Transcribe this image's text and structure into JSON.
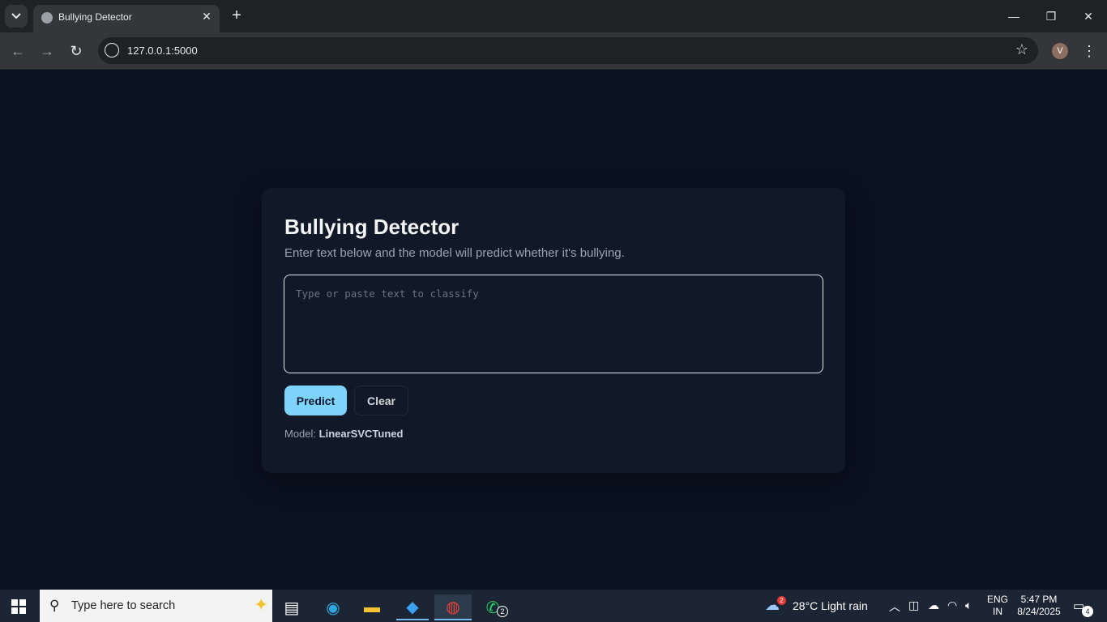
{
  "browser": {
    "tab_title": "Bullying Detector",
    "url": "127.0.0.1:5000",
    "profile_initial": "V"
  },
  "page": {
    "title": "Bullying Detector",
    "subtitle": "Enter text below and the model will predict whether it's bullying.",
    "input_placeholder": "Type or paste text to classify",
    "input_value": "",
    "predict_label": "Predict",
    "clear_label": "Clear",
    "model_prefix": "Model:",
    "model_name": "LinearSVCTuned"
  },
  "taskbar": {
    "search_placeholder": "Type here to search",
    "weather": "28°C  Light rain",
    "weather_badge": "2",
    "whatsapp_badge": "2",
    "lang_line1": "ENG",
    "lang_line2": "IN",
    "time": "5:47 PM",
    "date": "8/24/2025",
    "notification_count": "4"
  },
  "icons": {
    "tab_search": "chevron-down-icon",
    "back": "arrow-left-icon",
    "forward": "arrow-right-icon",
    "reload": "reload-icon",
    "bookmark": "star-icon",
    "menu": "kebab-menu-icon"
  },
  "colors": {
    "page_bg": "#0a1120",
    "card_bg": "#111827",
    "accent": "#7dd3fc"
  }
}
